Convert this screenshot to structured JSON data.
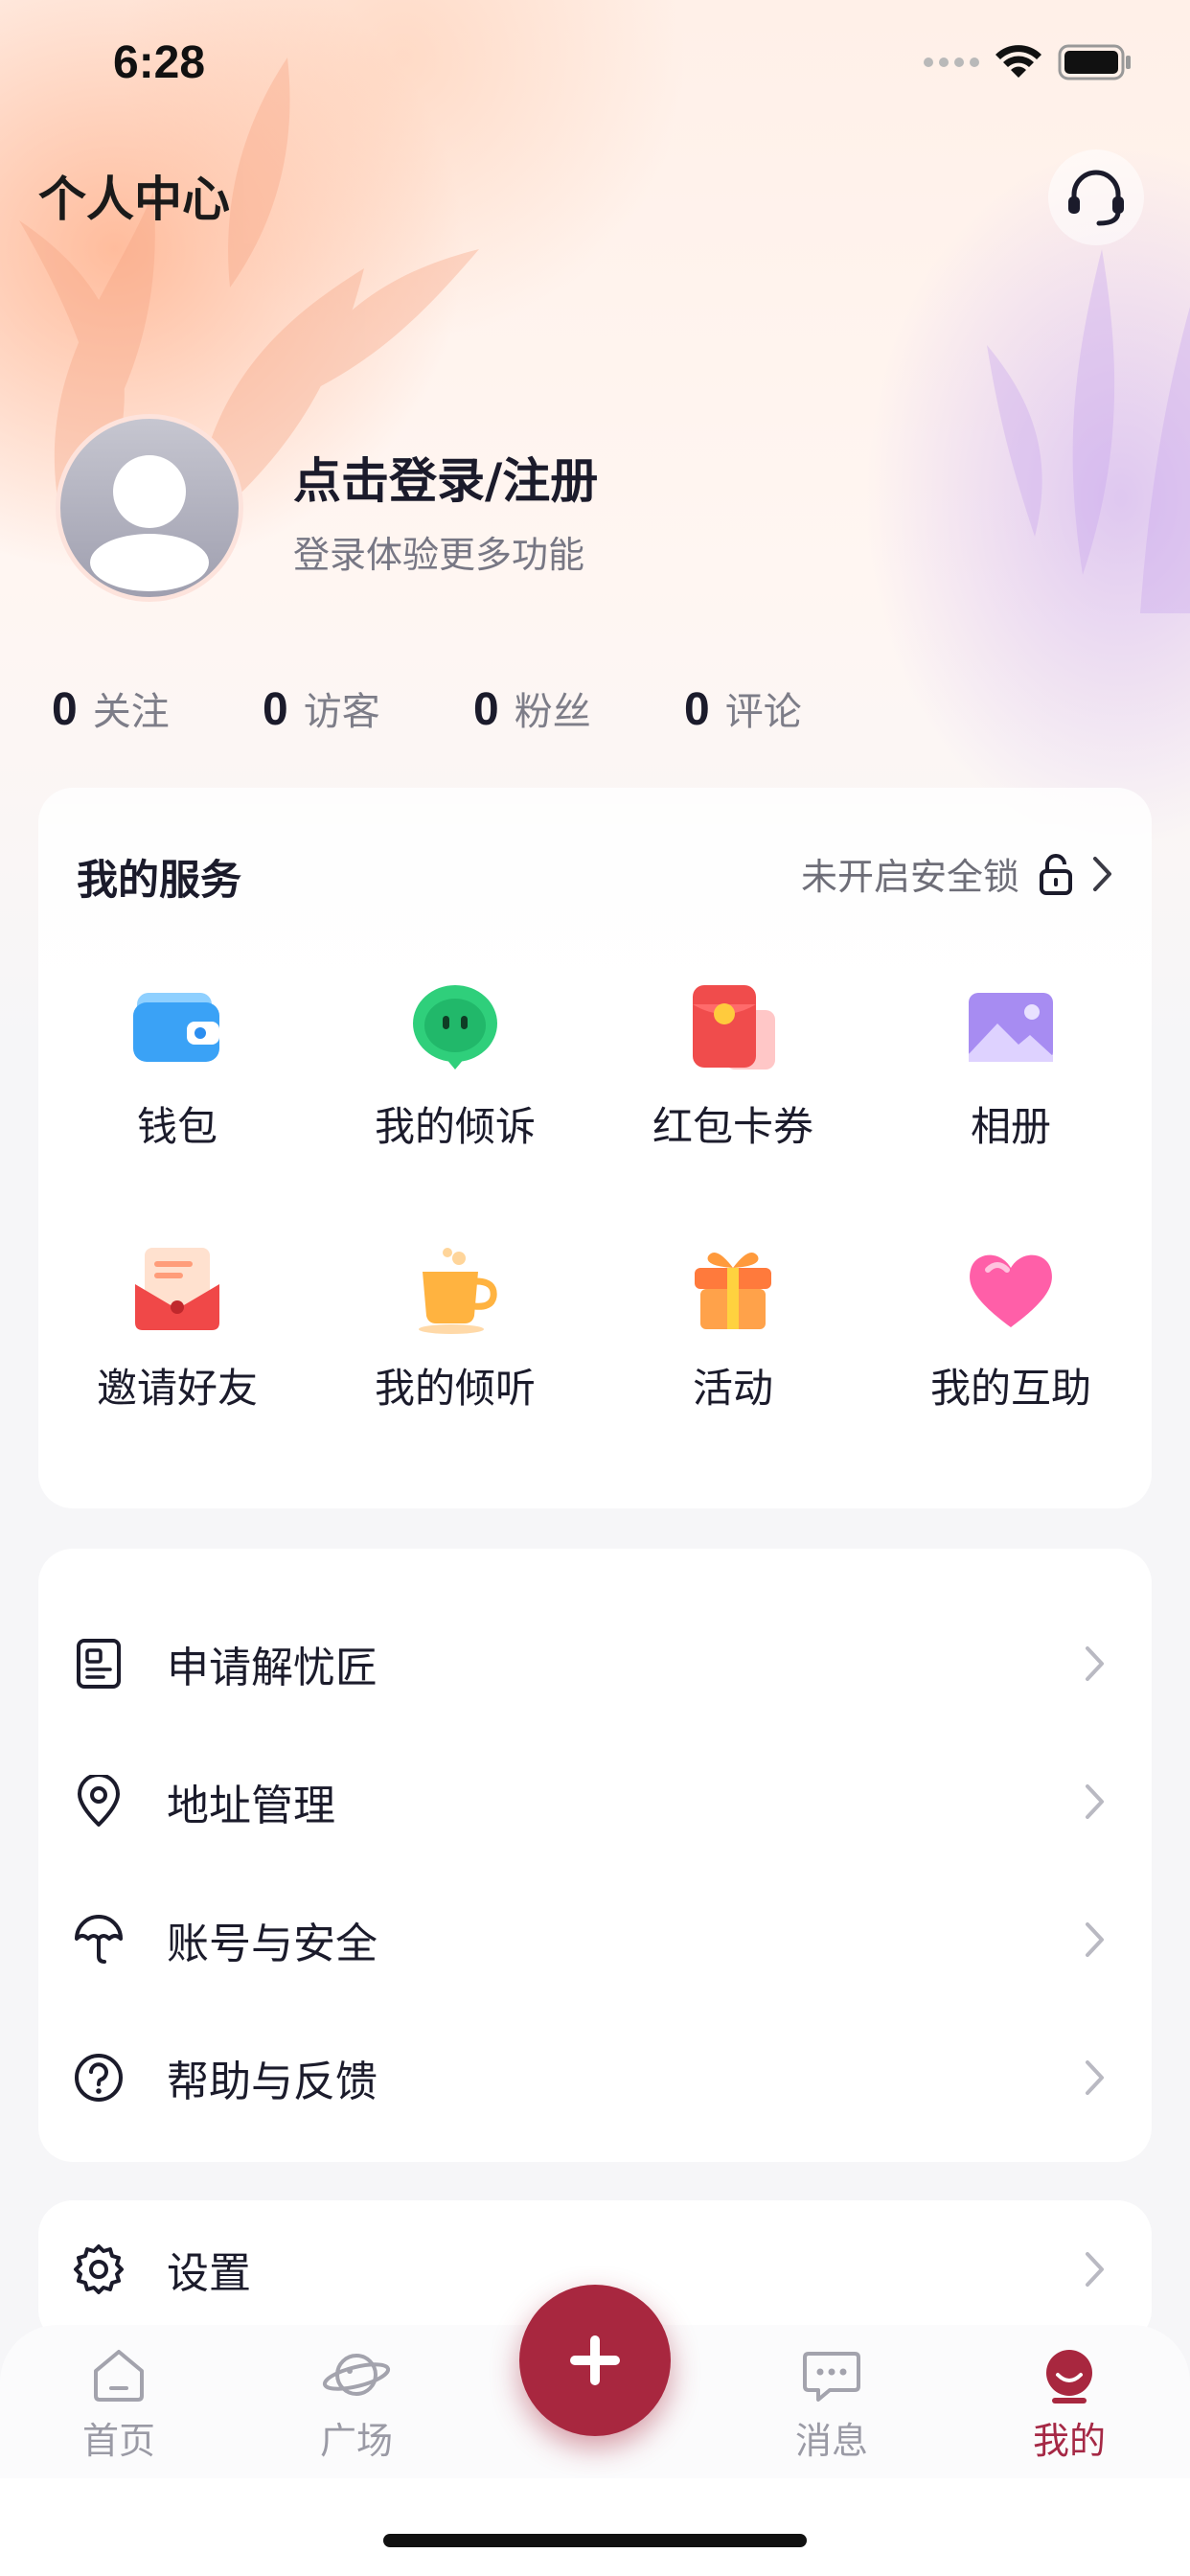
{
  "status_bar": {
    "time": "6:28"
  },
  "header": {
    "title": "个人中心"
  },
  "profile": {
    "login_title": "点击登录/注册",
    "login_subtitle": "登录体验更多功能"
  },
  "stats": [
    {
      "value": "0",
      "label": "关注"
    },
    {
      "value": "0",
      "label": "访客"
    },
    {
      "value": "0",
      "label": "粉丝"
    },
    {
      "value": "0",
      "label": "评论"
    }
  ],
  "services": {
    "title": "我的服务",
    "lock_status": "未开启安全锁",
    "items": [
      {
        "label": "钱包",
        "icon": "wallet-icon"
      },
      {
        "label": "我的倾诉",
        "icon": "chat-bubble-face-icon"
      },
      {
        "label": "红包卡券",
        "icon": "red-envelope-icon"
      },
      {
        "label": "相册",
        "icon": "photo-album-icon"
      },
      {
        "label": "邀请好友",
        "icon": "invite-envelope-icon"
      },
      {
        "label": "我的倾听",
        "icon": "coffee-cup-icon"
      },
      {
        "label": "活动",
        "icon": "gift-icon"
      },
      {
        "label": "我的互助",
        "icon": "heart-icon"
      }
    ]
  },
  "menu": [
    {
      "label": "申请解忧匠",
      "icon": "document-icon"
    },
    {
      "label": "地址管理",
      "icon": "location-pin-icon"
    },
    {
      "label": "账号与安全",
      "icon": "umbrella-icon"
    },
    {
      "label": "帮助与反馈",
      "icon": "help-circle-icon"
    }
  ],
  "settings": {
    "label": "设置",
    "icon": "gear-icon"
  },
  "tab_bar": {
    "tabs": [
      {
        "label": "首页",
        "icon": "home-icon"
      },
      {
        "label": "广场",
        "icon": "planet-icon"
      },
      {
        "label": "消息",
        "icon": "message-icon"
      },
      {
        "label": "我的",
        "icon": "profile-smile-icon"
      }
    ],
    "active": "我的"
  },
  "colors": {
    "accent": "#a8273f",
    "text_primary": "#1b1b2b",
    "text_secondary": "#7d7d88"
  }
}
